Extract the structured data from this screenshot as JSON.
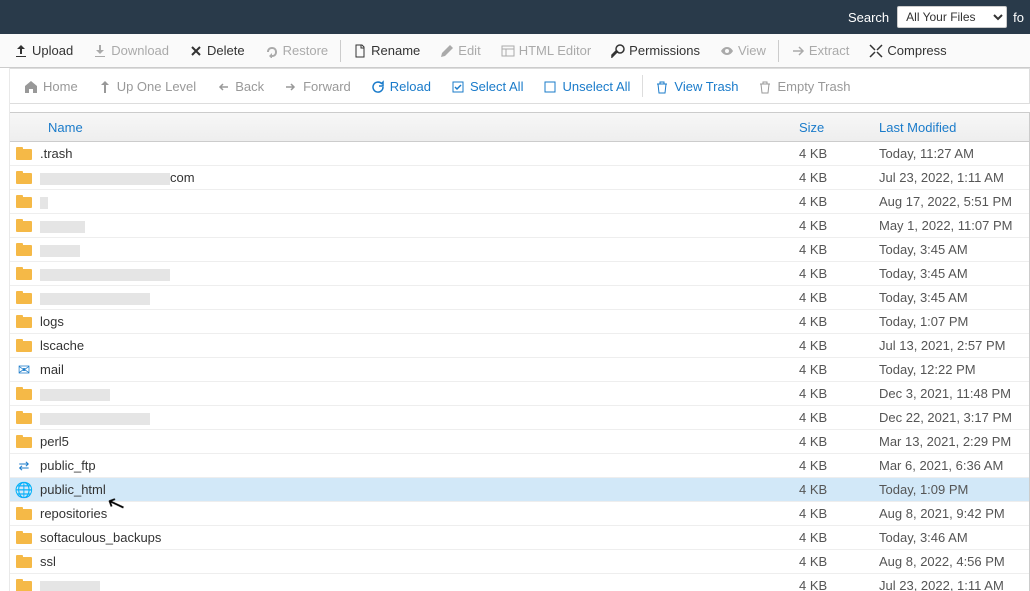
{
  "topbar": {
    "search_label": "Search",
    "select_value": "All Your Files",
    "trail": "fo"
  },
  "toolbar": [
    {
      "id": "upload",
      "label": "Upload",
      "icon": "upload",
      "enabled": true
    },
    {
      "id": "download",
      "label": "Download",
      "icon": "download",
      "enabled": false
    },
    {
      "id": "delete",
      "label": "Delete",
      "icon": "close",
      "enabled": true
    },
    {
      "id": "restore",
      "label": "Restore",
      "icon": "undo",
      "enabled": false
    },
    {
      "id": "divider"
    },
    {
      "id": "rename",
      "label": "Rename",
      "icon": "file",
      "enabled": true
    },
    {
      "id": "edit",
      "label": "Edit",
      "icon": "pencil",
      "enabled": false
    },
    {
      "id": "html-editor",
      "label": "HTML Editor",
      "icon": "layout",
      "enabled": false
    },
    {
      "id": "permissions",
      "label": "Permissions",
      "icon": "key",
      "enabled": true
    },
    {
      "id": "view",
      "label": "View",
      "icon": "eye",
      "enabled": false
    },
    {
      "id": "divider"
    },
    {
      "id": "extract",
      "label": "Extract",
      "icon": "extract",
      "enabled": false
    },
    {
      "id": "compress",
      "label": "Compress",
      "icon": "compress",
      "enabled": true
    }
  ],
  "navbar": [
    {
      "id": "home",
      "label": "Home",
      "icon": "home",
      "style": "gray"
    },
    {
      "id": "up",
      "label": "Up One Level",
      "icon": "level-up",
      "style": "gray"
    },
    {
      "id": "back",
      "label": "Back",
      "icon": "arrow-left",
      "style": "gray"
    },
    {
      "id": "forward",
      "label": "Forward",
      "icon": "arrow-right",
      "style": "gray"
    },
    {
      "id": "reload",
      "label": "Reload",
      "icon": "reload",
      "style": "blue"
    },
    {
      "id": "selectall",
      "label": "Select All",
      "icon": "check-square",
      "style": "blue"
    },
    {
      "id": "unselectall",
      "label": "Unselect All",
      "icon": "square",
      "style": "blue"
    },
    {
      "id": "sep"
    },
    {
      "id": "viewtrash",
      "label": "View Trash",
      "icon": "trash",
      "style": "blue"
    },
    {
      "id": "emptytrash",
      "label": "Empty Trash",
      "icon": "trash",
      "style": "gray"
    }
  ],
  "columns": {
    "name": "Name",
    "size": "Size",
    "modified": "Last Modified"
  },
  "rows": [
    {
      "icon": "folder",
      "name": ".trash",
      "size": "4 KB",
      "modified": "Today, 11:27 AM",
      "name_redacted": false
    },
    {
      "icon": "folder",
      "name_redacted": true,
      "redact_width": 130,
      "suffix": "com",
      "size": "4 KB",
      "modified": "Jul 23, 2022, 1:11 AM"
    },
    {
      "icon": "folder",
      "name_redacted": true,
      "redact_width": 8,
      "size": "4 KB",
      "modified": "Aug 17, 2022, 5:51 PM"
    },
    {
      "icon": "folder",
      "name_redacted": true,
      "redact_width": 45,
      "size": "4 KB",
      "modified": "May 1, 2022, 11:07 PM"
    },
    {
      "icon": "folder",
      "name_redacted": true,
      "redact_width": 40,
      "size": "4 KB",
      "modified": "Today, 3:45 AM"
    },
    {
      "icon": "folder",
      "name_redacted": true,
      "redact_width": 130,
      "size": "4 KB",
      "modified": "Today, 3:45 AM"
    },
    {
      "icon": "folder",
      "name_redacted": true,
      "redact_width": 110,
      "size": "4 KB",
      "modified": "Today, 3:45 AM"
    },
    {
      "icon": "folder",
      "name": "logs",
      "size": "4 KB",
      "modified": "Today, 1:07 PM"
    },
    {
      "icon": "folder",
      "name": "lscache",
      "size": "4 KB",
      "modified": "Jul 13, 2021, 2:57 PM"
    },
    {
      "icon": "mail",
      "name": "mail",
      "size": "4 KB",
      "modified": "Today, 12:22 PM"
    },
    {
      "icon": "folder",
      "name_redacted": true,
      "redact_width": 70,
      "size": "4 KB",
      "modified": "Dec 3, 2021, 11:48 PM"
    },
    {
      "icon": "folder",
      "name_redacted": true,
      "redact_width": 110,
      "size": "4 KB",
      "modified": "Dec 22, 2021, 3:17 PM"
    },
    {
      "icon": "folder",
      "name": "perl5",
      "size": "4 KB",
      "modified": "Mar 13, 2021, 2:29 PM"
    },
    {
      "icon": "swap",
      "name": "public_ftp",
      "size": "4 KB",
      "modified": "Mar 6, 2021, 6:36 AM"
    },
    {
      "icon": "globe",
      "name": "public_html",
      "size": "4 KB",
      "modified": "Today, 1:09 PM",
      "highlight": true
    },
    {
      "icon": "folder",
      "name": "repositories",
      "size": "4 KB",
      "modified": "Aug 8, 2021, 9:42 PM"
    },
    {
      "icon": "folder",
      "name": "softaculous_backups",
      "size": "4 KB",
      "modified": "Today, 3:46 AM"
    },
    {
      "icon": "folder",
      "name": "ssl",
      "size": "4 KB",
      "modified": "Aug 8, 2022, 4:56 PM"
    },
    {
      "icon": "folder",
      "name_redacted": true,
      "redact_width": 0,
      "size": "4 KB",
      "modified": "Jul 23, 2022, 1:11 AM"
    }
  ]
}
